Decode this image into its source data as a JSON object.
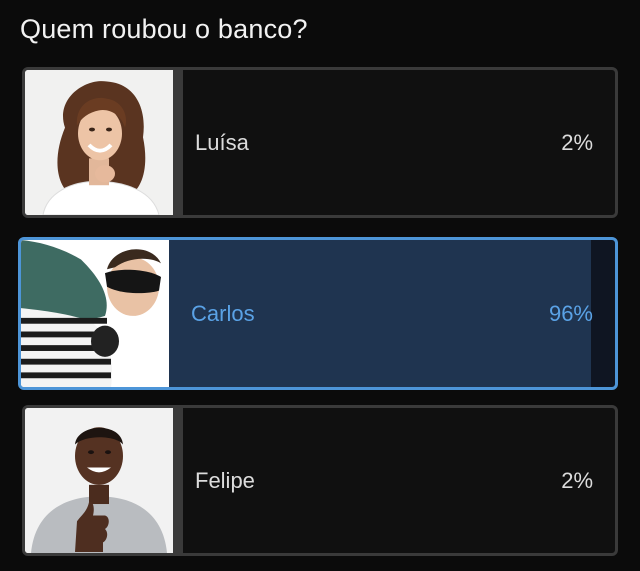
{
  "poll": {
    "question": "Quem roubou o banco?",
    "options": [
      {
        "label": "Luísa",
        "percent_text": "2%",
        "share": 0.02,
        "selected": false,
        "photo": "woman-curly-hair-photo"
      },
      {
        "label": "Carlos",
        "percent_text": "96%",
        "share": 0.96,
        "selected": true,
        "photo": "masked-thief-photo"
      },
      {
        "label": "Felipe",
        "percent_text": "2%",
        "share": 0.02,
        "selected": false,
        "photo": "man-thumbs-up-photo"
      }
    ]
  },
  "colors": {
    "background": "#0b0b0b",
    "card_border": "#3a3a3a",
    "selected_border": "#4d95d8",
    "selected_fill": "#1f3450",
    "selected_text": "#5aa2e6",
    "text": "#dcdcdc"
  }
}
